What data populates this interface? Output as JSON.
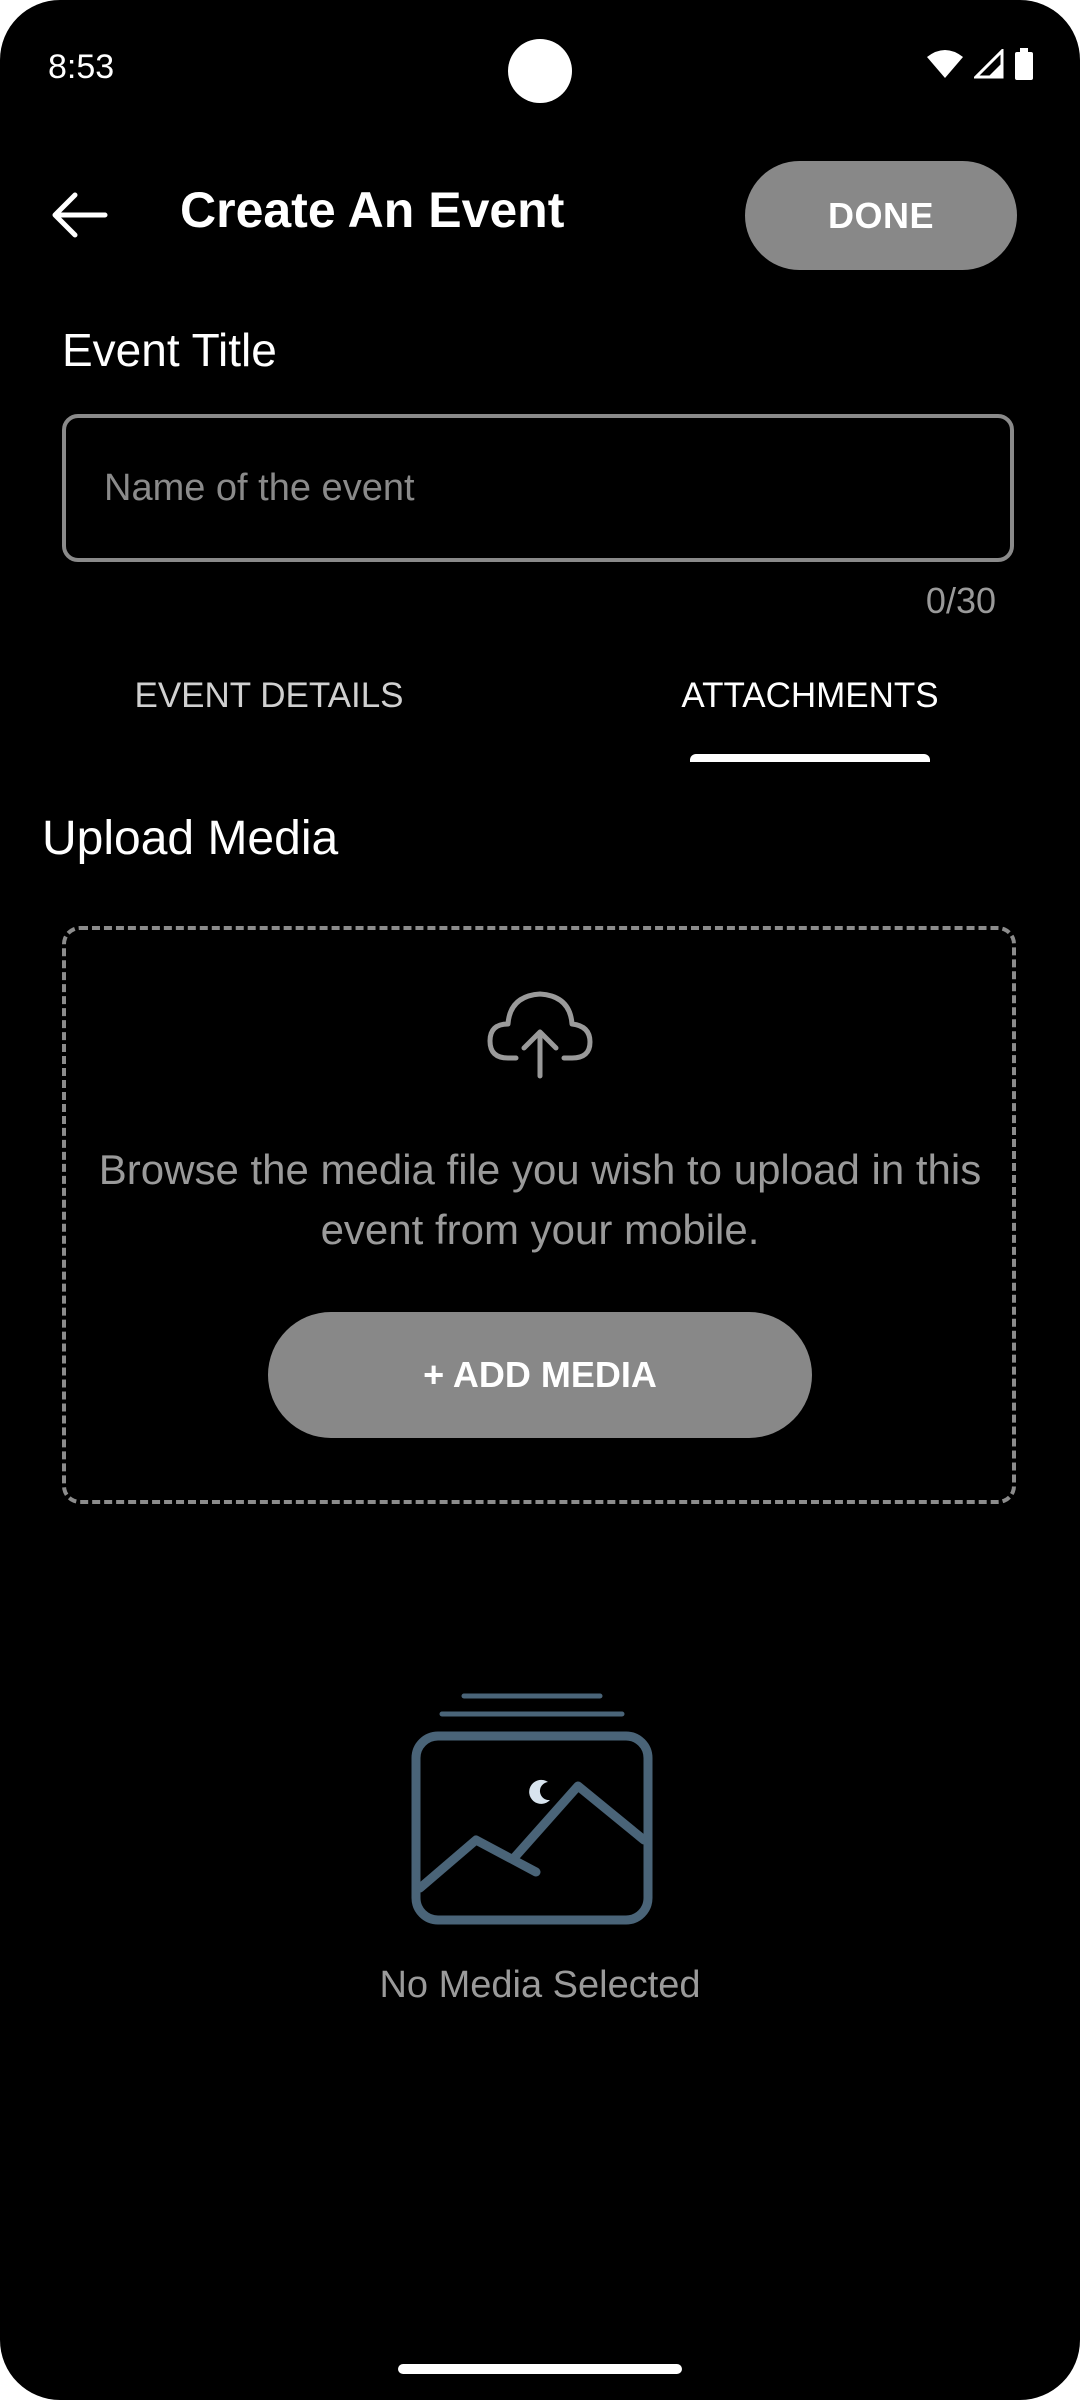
{
  "status_bar": {
    "time": "8:53",
    "icons": [
      "wifi-icon",
      "signal-icon",
      "battery-icon"
    ]
  },
  "header": {
    "back_icon": "arrow-left-icon",
    "title": "Create An Event",
    "done_label": "DONE"
  },
  "event_title": {
    "label": "Event Title",
    "placeholder": "Name of the event",
    "value": "",
    "counter": "0/30"
  },
  "tabs": [
    {
      "label": "EVENT DETAILS",
      "selected": false
    },
    {
      "label": "ATTACHMENTS",
      "selected": true
    }
  ],
  "upload": {
    "heading": "Upload Media",
    "icon": "cloud-upload-icon",
    "description": "Browse the media file you wish to upload in this event from your mobile.",
    "button_label": "+ ADD MEDIA"
  },
  "empty_state": {
    "icon": "image-placeholder-icon",
    "label": "No Media Selected"
  },
  "colors": {
    "background": "#000000",
    "button": "#888888",
    "muted_text": "#9a9a9a",
    "illustration": "#4a6478"
  }
}
